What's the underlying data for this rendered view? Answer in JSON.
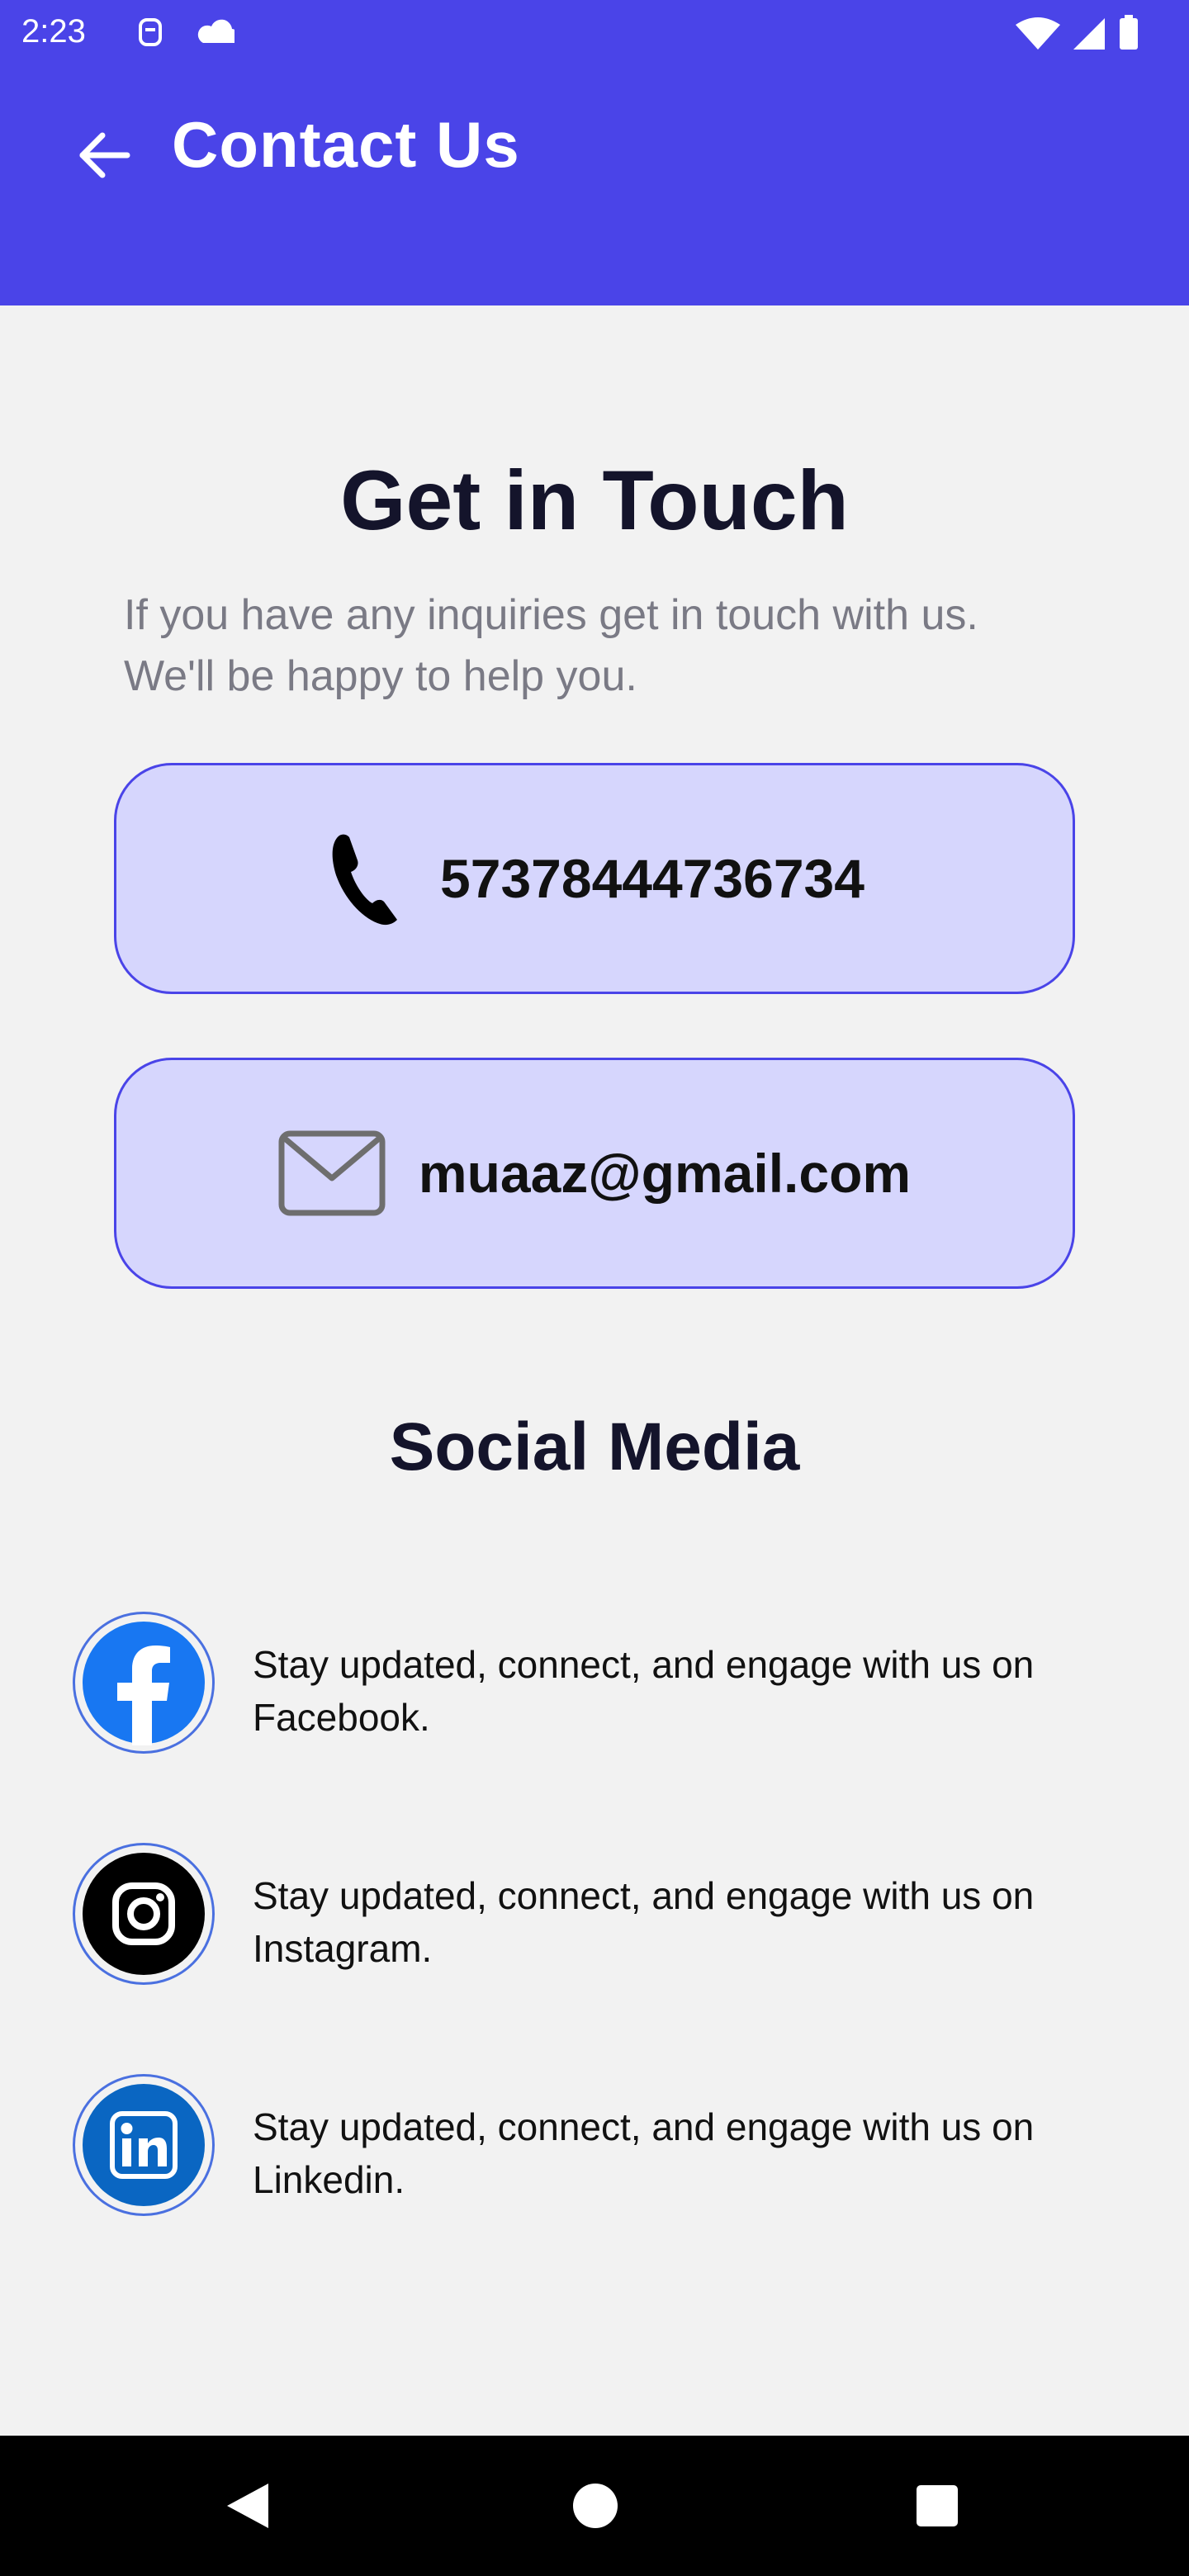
{
  "status_bar": {
    "time": "2:23"
  },
  "app_bar": {
    "title": "Contact Us"
  },
  "main": {
    "heading": "Get in Touch",
    "subtext_line1": "If you have any inquiries get in touch with us.",
    "subtext_line2": "We'll be happy to help you.",
    "contacts": [
      {
        "type": "phone",
        "icon": "phone-icon",
        "value": "57378444736734"
      },
      {
        "type": "email",
        "icon": "mail-icon",
        "value": "muaaz@gmail.com"
      }
    ],
    "social_heading": "Social Media",
    "social": [
      {
        "icon": "facebook-icon",
        "text": "Stay updated, connect, and engage with us on Facebook."
      },
      {
        "icon": "instagram-icon",
        "text": "Stay updated, connect, and engage with us on Instagram."
      },
      {
        "icon": "linkedin-icon",
        "text": "Stay updated, connect, and engage with us on Linkedin."
      }
    ]
  },
  "colors": {
    "primary": "#4a44e8",
    "card_bg": "#d6d6fd",
    "page_bg": "#f2f2f2",
    "facebook": "#1877f2",
    "linkedin": "#0a66c2"
  }
}
